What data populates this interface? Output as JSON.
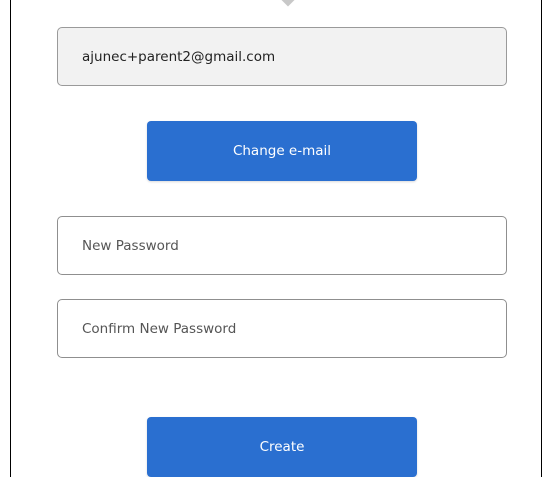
{
  "form": {
    "email_value": "ajunec+parent2@gmail.com",
    "change_email_label": "Change e-mail",
    "new_password_placeholder": "New Password",
    "confirm_password_placeholder": "Confirm New Password",
    "create_label": "Create"
  },
  "colors": {
    "primary_button": "#2a6fd0",
    "button_text": "#ffffff",
    "field_border": "#8f8f8f",
    "readonly_field_bg": "#f2f2f2"
  }
}
